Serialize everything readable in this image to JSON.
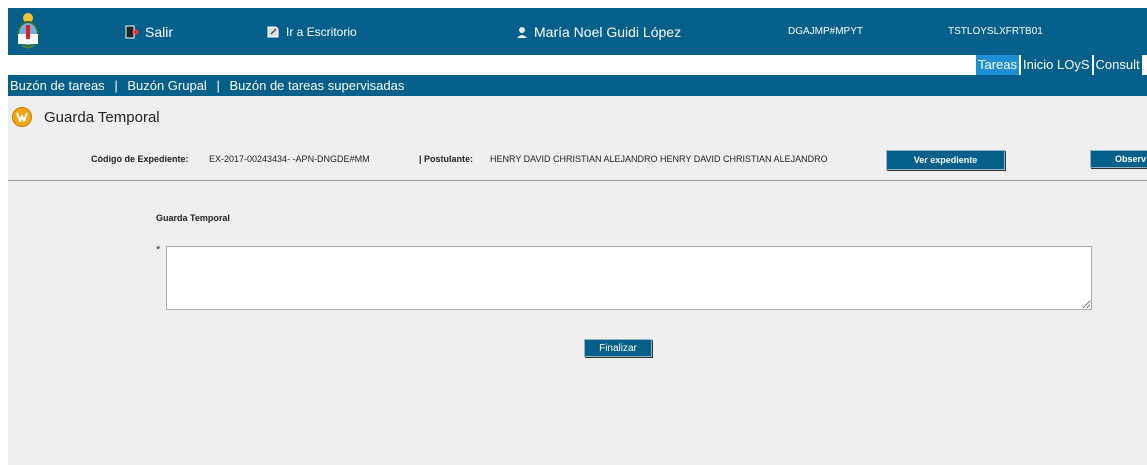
{
  "header": {
    "logout_label": "Salir",
    "desktop_label": "Ir a Escritorio",
    "user_name": "María Noel Guidi López",
    "department": "DGAJMP#MPYT",
    "server": "TSTLOYSLXFRTB01"
  },
  "tabs": [
    {
      "label": "Tareas",
      "active": true
    },
    {
      "label": "Inicio LOyS",
      "active": false
    },
    {
      "label": "Consult",
      "active": false
    }
  ],
  "nav": {
    "items": [
      "Buzón de tareas",
      "Buzón Grupal",
      "Buzón de tareas supervisadas"
    ],
    "separator": "|"
  },
  "page": {
    "title": "Guarda Temporal"
  },
  "expediente": {
    "code_label": "Código de Expediente:",
    "code_value": "EX-2017-00243434- -APN-DNGDE#MM",
    "postulante_label": "| Postulante:",
    "postulante_value": "HENRY DAVID CHRISTIAN ALEJANDRO HENRY DAVID CHRISTIAN ALEJANDRO",
    "view_button": "Ver expediente",
    "observ_button": "Observ"
  },
  "form": {
    "section_label": "Guarda Temporal",
    "required_mark": "*",
    "text_value": "",
    "submit_label": "Finalizar"
  },
  "colors": {
    "primary": "#045f8a",
    "active_tab": "#1d8fd2",
    "content_bg": "#efefef"
  }
}
